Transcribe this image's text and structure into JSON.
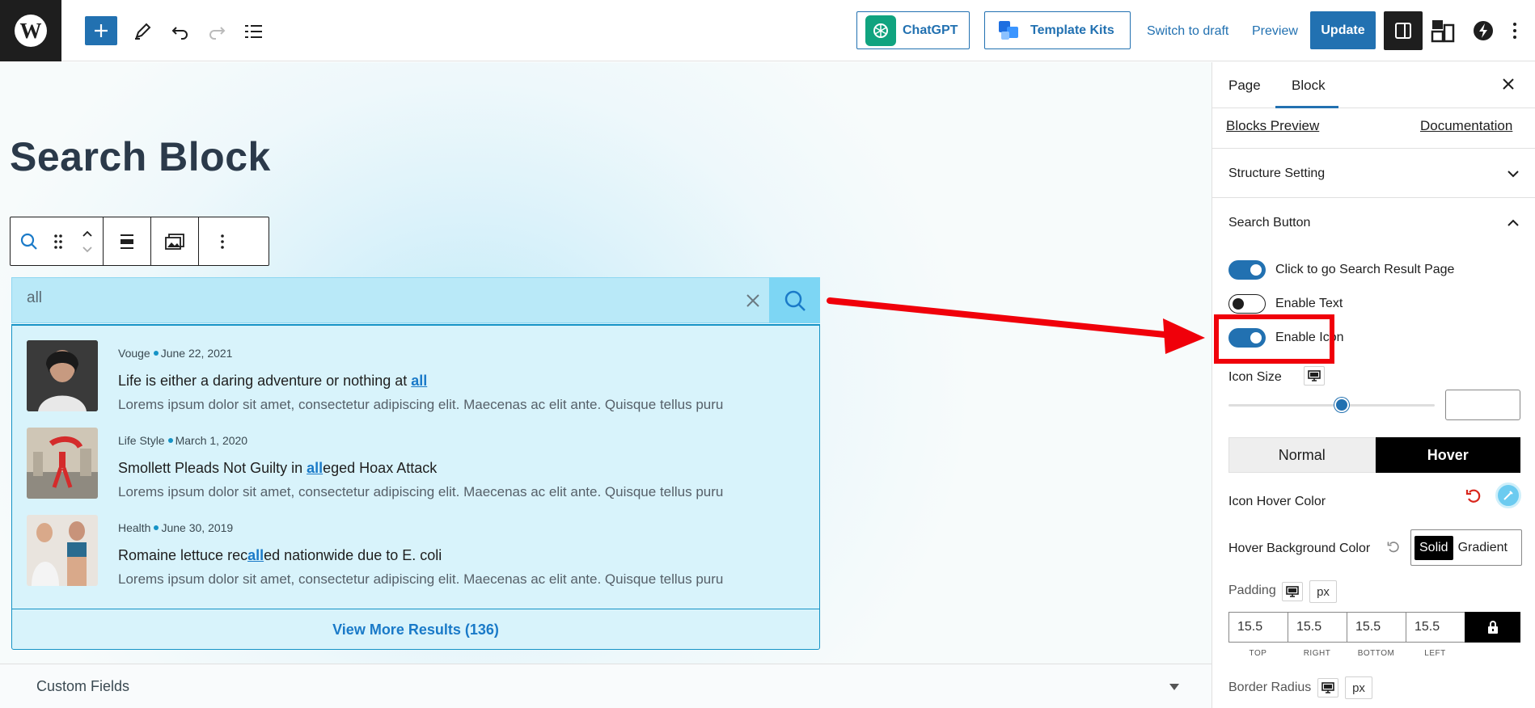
{
  "topbar": {
    "logo_letter": "W",
    "chatgpt_label": "ChatGPT",
    "template_kits_label": "Template Kits",
    "switch_draft_label": "Switch to draft",
    "preview_label": "Preview",
    "update_label": "Update",
    "accent_color": "#2271b1"
  },
  "canvas": {
    "page_title": "Search Block",
    "search": {
      "value": "all"
    },
    "results": [
      {
        "category": "Vouge",
        "date": "June 22, 2021",
        "title_before": "Life is either a daring adventure or nothing at ",
        "title_highlight": "all",
        "title_after": "",
        "excerpt": "Lorems ipsum dolor sit amet, consectetur adipiscing elit. Maecenas ac elit ante. Quisque tellus puru"
      },
      {
        "category": "Life Style",
        "date": "March 1, 2020",
        "title_before": "Smollett Pleads Not Guilty in ",
        "title_highlight": "all",
        "title_after": "eged Hoax Attack",
        "excerpt": "Lorems ipsum dolor sit amet, consectetur adipiscing elit. Maecenas ac elit ante. Quisque tellus puru"
      },
      {
        "category": "Health",
        "date": "June 30, 2019",
        "title_before": "Romaine lettuce rec",
        "title_highlight": "all",
        "title_after": "ed nationwide due to E. coli",
        "excerpt": "Lorems ipsum dolor sit amet, consectetur adipiscing elit. Maecenas ac elit ante. Quisque tellus puru"
      }
    ],
    "view_more_label": "View More Results (136)",
    "custom_fields_label": "Custom Fields"
  },
  "sidebar": {
    "tabs": [
      "Page",
      "Block"
    ],
    "active_tab": "Block",
    "blocks_preview_label": "Blocks Preview",
    "documentation_label": "Documentation",
    "structure_setting_label": "Structure Setting",
    "search_button_label": "Search Button",
    "toggles": [
      {
        "label": "Click to go Search Result Page",
        "on": true
      },
      {
        "label": "Enable Text",
        "on": false
      },
      {
        "label": "Enable Icon",
        "on": true
      }
    ],
    "icon_size_label": "Icon Size",
    "icon_size_slider_fraction": 0.55,
    "state_tabs": [
      "Normal",
      "Hover"
    ],
    "active_state": "Hover",
    "icon_hover_color_label": "Icon Hover Color",
    "icon_hover_color": "#6ccbf0",
    "hover_bg_label": "Hover Background Color",
    "bg_type_options": [
      "Solid",
      "Gradient"
    ],
    "bg_type_selected": "Solid",
    "padding_label": "Padding",
    "padding_unit": "px",
    "padding": {
      "top": "15.5",
      "right": "15.5",
      "bottom": "15.5",
      "left": "15.5"
    },
    "padding_captions": [
      "TOP",
      "RIGHT",
      "BOTTOM",
      "LEFT"
    ],
    "border_radius_label": "Border Radius",
    "border_radius_unit": "px"
  }
}
